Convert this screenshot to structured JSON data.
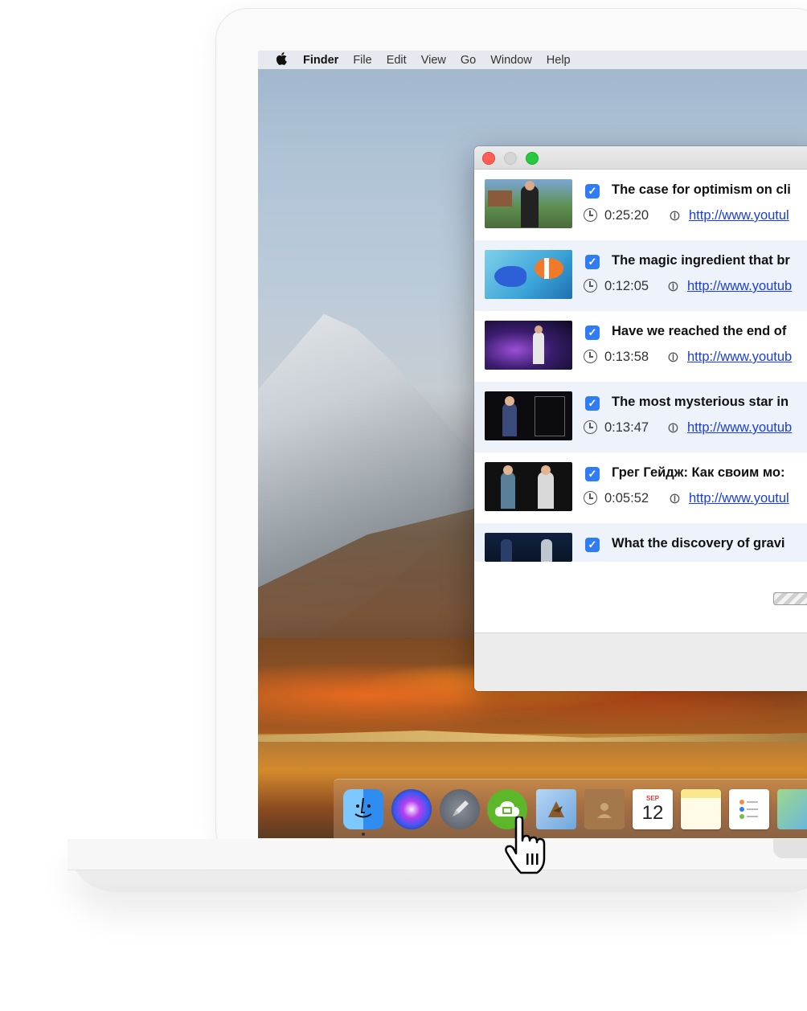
{
  "menubar": {
    "items": [
      "Finder",
      "File",
      "Edit",
      "View",
      "Go",
      "Window",
      "Help"
    ]
  },
  "videos": [
    {
      "title": "The case for optimism on cli",
      "duration": "0:25:20",
      "url": "http://www.youtul"
    },
    {
      "title": "The magic ingredient that br",
      "duration": "0:12:05",
      "url": "http://www.youtub"
    },
    {
      "title": "Have we reached the end of",
      "duration": "0:13:58",
      "url": "http://www.youtub"
    },
    {
      "title": "The most mysterious star in",
      "duration": "0:13:47",
      "url": "http://www.youtub"
    },
    {
      "title": "Грег Гейдж: Как своим мо:",
      "duration": "0:05:52",
      "url": "http://www.youtul"
    },
    {
      "title": "What the discovery of gravi",
      "duration": "",
      "url": ""
    }
  ],
  "dock": {
    "calendar_month": "SEP",
    "calendar_day": "12"
  },
  "colors": {
    "accent": "#2f7cf6",
    "link": "#1a3fd6",
    "app_icon_green": "#5cb82a"
  }
}
